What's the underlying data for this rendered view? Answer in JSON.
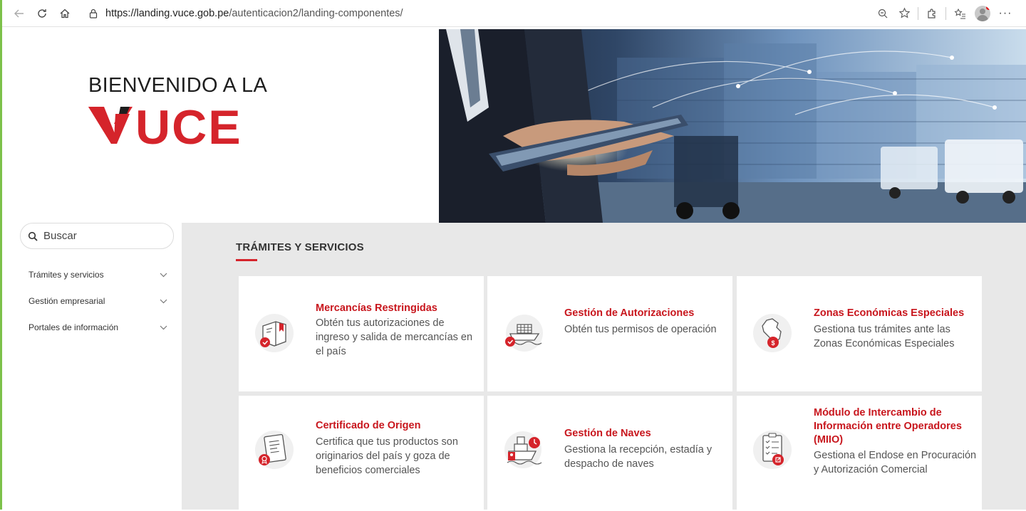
{
  "browser": {
    "url_host": "https://landing.vuce.gob.pe",
    "url_path": "/autenticacion2/landing-componentes/"
  },
  "hero": {
    "title": "BIENVENIDO A LA",
    "logo_text": "VUCE"
  },
  "sidebar": {
    "search_placeholder": "Buscar",
    "items": [
      {
        "label": "Trámites y servicios"
      },
      {
        "label": "Gestión empresarial"
      },
      {
        "label": "Portales de información"
      }
    ]
  },
  "main": {
    "section_title": "TRÁMITES Y SERVICIOS",
    "cards": [
      {
        "title": "Mercancías Restringidas",
        "desc": "Obtén tus autorizaciones de ingreso y salida de mercancías en el país",
        "icon": "package-icon"
      },
      {
        "title": "Gestión de Autorizaciones",
        "desc": "Obtén tus permisos de operación",
        "icon": "cargo-ship-icon"
      },
      {
        "title": "Zonas Económicas Especiales",
        "desc": "Gestiona tus trámites ante las Zonas Económicas Especiales",
        "icon": "peru-map-icon"
      },
      {
        "title": "Certificado de Origen",
        "desc": "Certifica que tus productos son originarios del país y goza de beneficios comerciales",
        "icon": "certificate-icon"
      },
      {
        "title": "Gestión de Naves",
        "desc": "Gestiona la recepción, estadía y despacho de naves",
        "icon": "ship-icon"
      },
      {
        "title": "Módulo de Intercambio de Información entre Operadores (MIIO)",
        "desc": "Gestiona el Endose en Procuración y Autorización Comercial",
        "icon": "checklist-icon"
      }
    ]
  },
  "colors": {
    "brand_red": "#d5242b",
    "title_red": "#c8161d",
    "panel_gray": "#e8e8e8"
  }
}
